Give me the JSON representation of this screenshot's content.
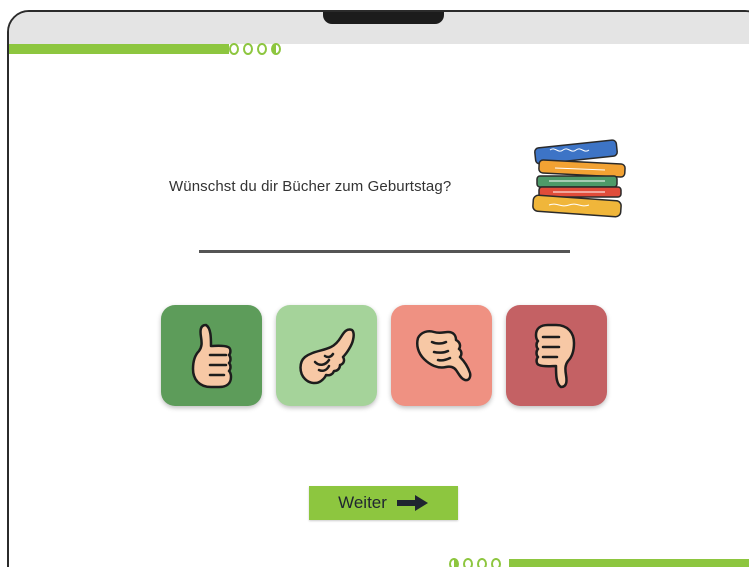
{
  "question": {
    "text": "Wünschst du dir Bücher zum Geburtstag?"
  },
  "ratings": [
    {
      "icon": "thumbs-up-icon",
      "color": "#5d9c5a"
    },
    {
      "icon": "thumb-tilted-up-icon",
      "color": "#a5d39a"
    },
    {
      "icon": "thumb-tilted-down-icon",
      "color": "#ef9182"
    },
    {
      "icon": "thumbs-down-icon",
      "color": "#c46164"
    }
  ],
  "next_button": {
    "label": "Weiter",
    "icon": "arrow-right-icon"
  },
  "colors": {
    "accent": "#8dc63f",
    "frame": "#2b2b2b",
    "topbar": "#e4e4e4"
  }
}
